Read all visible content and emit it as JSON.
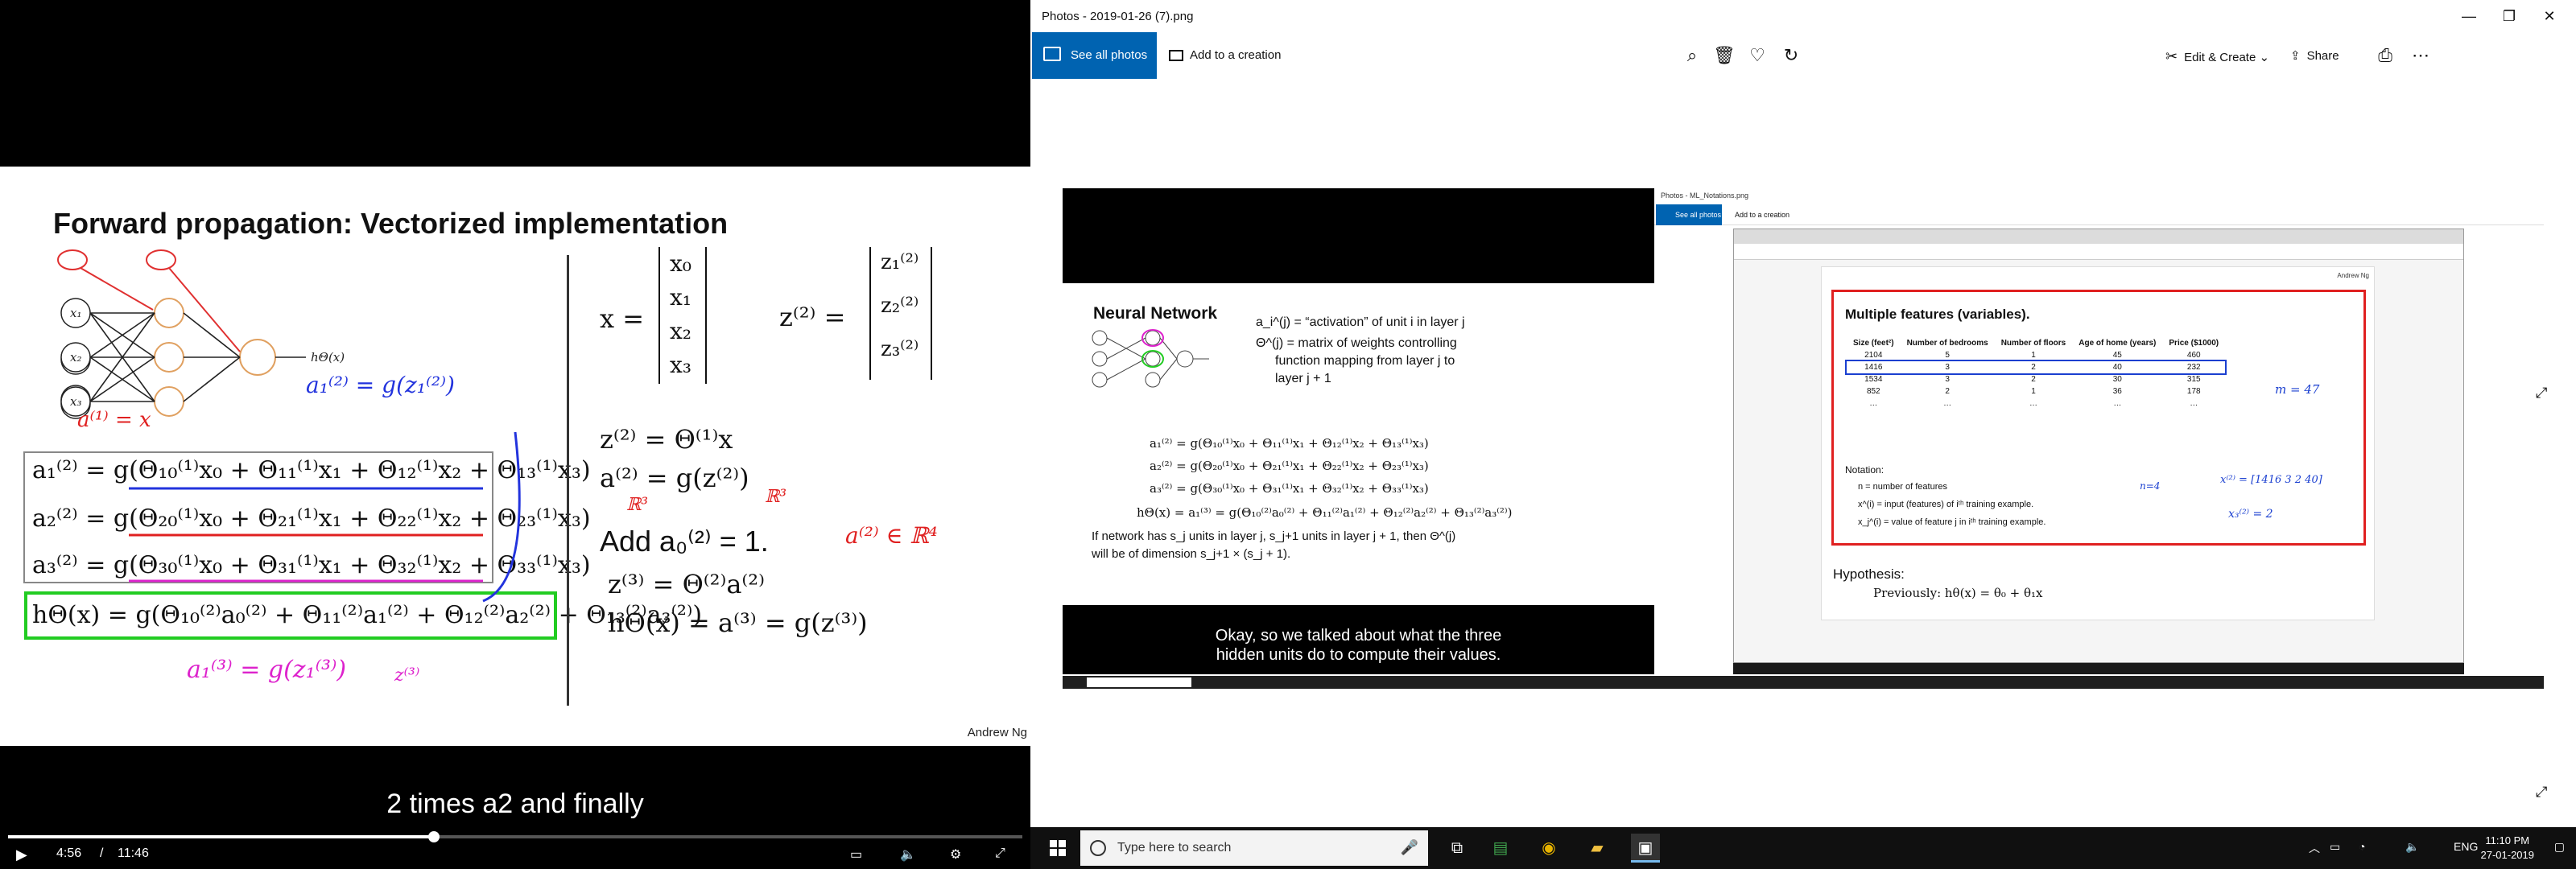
{
  "video": {
    "slide_title": "Forward propagation: Vectorized implementation",
    "author": "Andrew Ng",
    "subtitle": "2 times a2 and finally",
    "time_current": "4:56",
    "time_total": "11:46",
    "separator": "/",
    "progress": 0.42,
    "hx": "hΘ(x)",
    "eq_a1": "a₁⁽²⁾ = g(Θ₁₀⁽¹⁾x₀ + Θ₁₁⁽¹⁾x₁ + Θ₁₂⁽¹⁾x₂ + Θ₁₃⁽¹⁾x₃)",
    "eq_a2": "a₂⁽²⁾ = g(Θ₂₀⁽¹⁾x₀ + Θ₂₁⁽¹⁾x₁ + Θ₂₂⁽¹⁾x₂ + Θ₂₃⁽¹⁾x₃)",
    "eq_a3": "a₃⁽²⁾ = g(Θ₃₀⁽¹⁾x₀ + Θ₃₁⁽¹⁾x₁ + Θ₃₂⁽¹⁾x₂ + Θ₃₃⁽¹⁾x₃)",
    "eq_h": "hΘ(x) = g(Θ₁₀⁽²⁾a₀⁽²⁾ + Θ₁₁⁽²⁾a₁⁽²⁾ + Θ₁₂⁽²⁾a₂⁽²⁾ + Θ₁₃⁽²⁾a₃⁽²⁾)",
    "x_lhs": "x =",
    "x_vec": [
      "x₀",
      "x₁",
      "x₂",
      "x₃"
    ],
    "z_lhs": "z⁽²⁾ =",
    "z_vec": [
      "z₁⁽²⁾",
      "z₂⁽²⁾",
      "z₃⁽²⁾"
    ],
    "eq_z2": "z⁽²⁾ = Θ⁽¹⁾x",
    "eq_a2v": "a⁽²⁾ = g(z⁽²⁾)",
    "eq_add": "Add a₀⁽²⁾ = 1.",
    "eq_z3": "z⁽³⁾ = Θ⁽²⁾a⁽²⁾",
    "eq_hv": "hΘ(x) = a⁽³⁾ = g(z⁽³⁾)",
    "ink": {
      "a1_eq": "a⁽¹⁾ = x",
      "a2_g": "a₁⁽²⁾ = g(z₁⁽²⁾)",
      "a3_g": "a₁⁽³⁾ = g(z₁⁽³⁾)",
      "z3": "z⁽³⁾",
      "r4": "a⁽²⁾ ∈ ℝ⁴",
      "r3a": "ℝ³",
      "r3b": "ℝ³"
    }
  },
  "photos": {
    "window_title": "Photos - 2019-01-26 (7).png",
    "see_all": "See all photos",
    "add_creation": "Add to a creation",
    "edit_create": "Edit & Create",
    "share": "Share",
    "icons": [
      "zoom-in-icon",
      "delete-icon",
      "heart-icon",
      "rotate-icon",
      "print-icon",
      "more-icon"
    ]
  },
  "inner": {
    "nn_title": "Neural Network",
    "activation": "a_i^(j) = “activation” of unit i in layer j",
    "theta_line1": "Θ^(j) = matrix of weights controlling",
    "theta_line2": "function mapping from layer j to",
    "theta_line3": "layer j + 1",
    "eq1": "a₁⁽²⁾ = g(Θ₁₀⁽¹⁾x₀ + Θ₁₁⁽¹⁾x₁ + Θ₁₂⁽¹⁾x₂ + Θ₁₃⁽¹⁾x₃)",
    "eq2": "a₂⁽²⁾ = g(Θ₂₀⁽¹⁾x₀ + Θ₂₁⁽¹⁾x₁ + Θ₂₂⁽¹⁾x₂ + Θ₂₃⁽¹⁾x₃)",
    "eq3": "a₃⁽²⁾ = g(Θ₃₀⁽¹⁾x₀ + Θ₃₁⁽¹⁾x₁ + Θ₃₂⁽¹⁾x₂ + Θ₃₃⁽¹⁾x₃)",
    "eq4": "hΘ(x) = a₁⁽³⁾ = g(Θ₁₀⁽²⁾a₀⁽²⁾ + Θ₁₁⁽²⁾a₁⁽²⁾ + Θ₁₂⁽²⁾a₂⁽²⁾ + Θ₁₃⁽²⁾a₃⁽²⁾)",
    "dim1": "If network has s_j units in layer j, s_j+1 units in layer j + 1, then Θ^(j)",
    "dim2": "will be of dimension s_j+1 × (s_j + 1).",
    "subtitle1": "Okay, so we talked about what the three",
    "subtitle2": "hidden units do to compute their values.",
    "right_title": "Photos - ML_Notations.png",
    "right_see_all": "See all photos",
    "right_add": "Add to a creation",
    "pdf_heading": "Multiple features (variables).",
    "pdf_author": "Andrew Ng",
    "headers": [
      "Size (feet²)",
      "Number of bedrooms",
      "Number of floors",
      "Age of home (years)",
      "Price ($1000)"
    ],
    "rows": [
      [
        "2104",
        "5",
        "1",
        "45",
        "460"
      ],
      [
        "1416",
        "3",
        "2",
        "40",
        "232"
      ],
      [
        "1534",
        "3",
        "2",
        "30",
        "315"
      ],
      [
        "852",
        "2",
        "1",
        "36",
        "178"
      ],
      [
        "…",
        "…",
        "…",
        "…",
        "…"
      ]
    ],
    "notation_title": "Notation:",
    "note_n": "n = number of features",
    "note_x": "x^(i) = input (features) of iᵗʰ training example.",
    "note_xj": "x_j^(i) = value of feature j in iᵗʰ training example.",
    "hypothesis": "Hypothesis:",
    "previously": "Previously:   hθ(x) = θ₀ + θ₁x",
    "ink_m": "m = 47",
    "ink_n": "n=4",
    "ink_vec": "x⁽²⁾ = [1416 3 2 40]",
    "ink_x32": "x₃⁽²⁾ = 2"
  },
  "taskbar": {
    "search_placeholder": "Type here to search",
    "lang": "ENG",
    "time": "11:10 PM",
    "date": "27-01-2019",
    "apps": [
      "task-view-icon",
      "excel-icon",
      "chrome-icon",
      "file-explorer-icon",
      "photos-icon"
    ]
  }
}
